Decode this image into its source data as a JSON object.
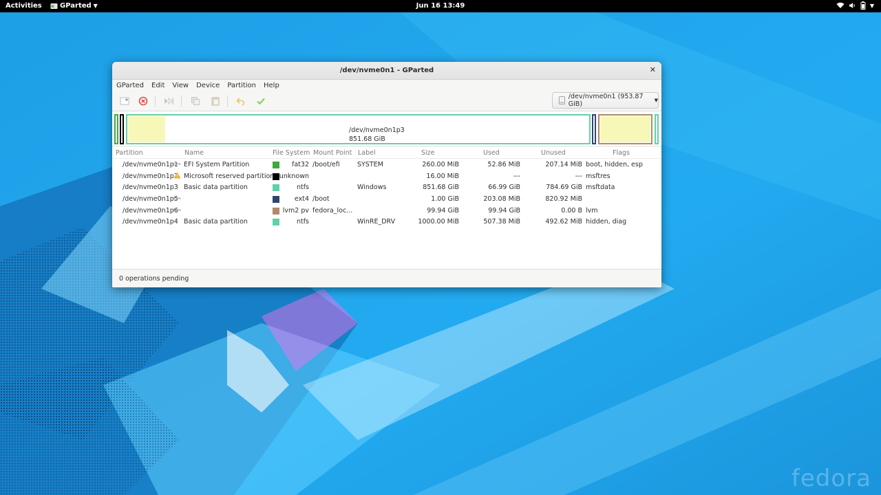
{
  "topbar": {
    "activities": "Activities",
    "app_menu": "GParted",
    "clock": "Jun 16  13:49"
  },
  "desktop": {
    "logo_text": "fedora"
  },
  "window": {
    "title": "/dev/nvme0n1 - GParted",
    "menus": [
      "GParted",
      "Edit",
      "View",
      "Device",
      "Partition",
      "Help"
    ],
    "device_selector": "/dev/nvme0n1 (953.87 GiB)",
    "bar_label": {
      "name": "/dev/nvme0n1p3",
      "size": "851.68 GiB"
    },
    "columns": [
      "Partition",
      "Name",
      "File System",
      "Mount Point",
      "Label",
      "Size",
      "Used",
      "Unused",
      "Flags"
    ],
    "rows": [
      {
        "partition": "/dev/nvme0n1p1",
        "name": "EFI System Partition",
        "fs": "fat32",
        "fs_color": "#3ea93e",
        "mount": "/boot/efi",
        "label": "SYSTEM",
        "size": "260.00 MiB",
        "used": "52.86 MiB",
        "unused": "207.14 MiB",
        "flags": "boot, hidden, esp",
        "icon": "key-icon"
      },
      {
        "partition": "/dev/nvme0n1p2",
        "name": "Microsoft reserved partition",
        "fs": "unknown",
        "fs_color": "#000000",
        "mount": "",
        "label": "",
        "size": "16.00 MiB",
        "used": "---",
        "unused": "---",
        "flags": "msftres",
        "icon": "warning-icon"
      },
      {
        "partition": "/dev/nvme0n1p3",
        "name": "Basic data partition",
        "fs": "ntfs",
        "fs_color": "#5fd1a8",
        "mount": "",
        "label": "Windows",
        "size": "851.68 GiB",
        "used": "66.99 GiB",
        "unused": "784.69 GiB",
        "flags": "msftdata",
        "icon": ""
      },
      {
        "partition": "/dev/nvme0n1p5",
        "name": "",
        "fs": "ext4",
        "fs_color": "#2e456f",
        "mount": "/boot",
        "label": "",
        "size": "1.00 GiB",
        "used": "203.08 MiB",
        "unused": "820.92 MiB",
        "flags": "",
        "icon": "key-icon"
      },
      {
        "partition": "/dev/nvme0n1p6",
        "name": "",
        "fs": "lvm2 pv",
        "fs_color": "#b0896a",
        "mount": "fedora_loc...",
        "label": "",
        "size": "99.94 GiB",
        "used": "99.94 GiB",
        "unused": "0.00 B",
        "flags": "lvm",
        "icon": "key-icon"
      },
      {
        "partition": "/dev/nvme0n1p4",
        "name": "Basic data partition",
        "fs": "ntfs",
        "fs_color": "#5fd1a8",
        "mount": "",
        "label": "WinRE_DRV",
        "size": "1000.00 MiB",
        "used": "507.38 MiB",
        "unused": "492.62 MiB",
        "flags": "hidden, diag",
        "icon": ""
      }
    ],
    "status": "0 operations pending"
  }
}
